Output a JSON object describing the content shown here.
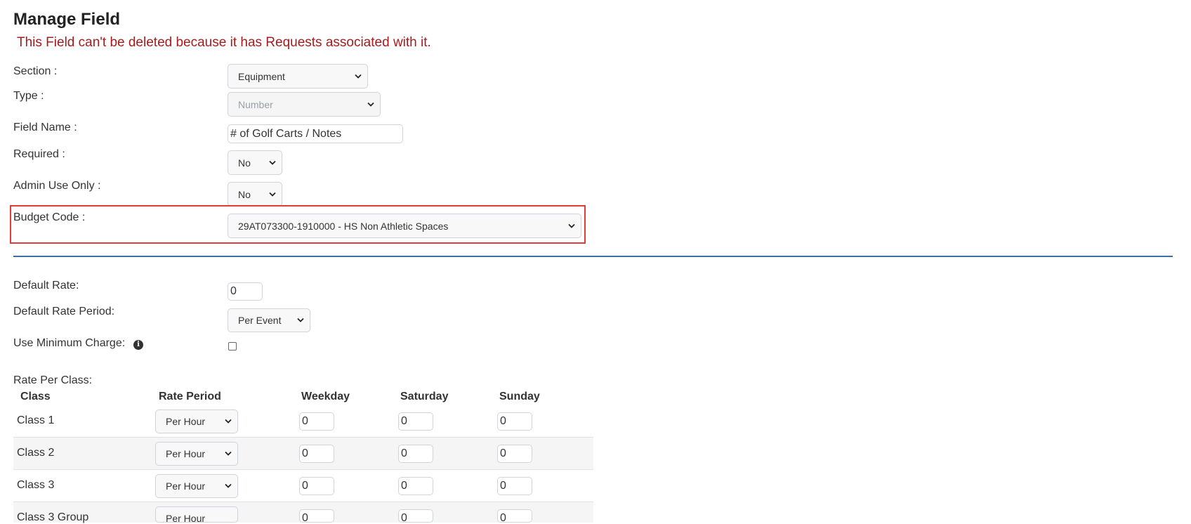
{
  "page": {
    "title": "Manage Field",
    "error_message": "This Field can't be deleted because it has Requests associated with it."
  },
  "form": {
    "section": {
      "label": "Section :",
      "value": "Equipment"
    },
    "type": {
      "label": "Type :",
      "value": "Number"
    },
    "field_name": {
      "label": "Field Name :",
      "value": "# of Golf Carts / Notes"
    },
    "required": {
      "label": "Required :",
      "value": "No"
    },
    "admin_use_only": {
      "label": "Admin Use Only :",
      "value": "No"
    },
    "budget_code": {
      "label": "Budget Code :",
      "value": "29AT073300-1910000 - HS Non Athletic Spaces"
    }
  },
  "rates": {
    "default_rate": {
      "label": "Default Rate:",
      "value": "0"
    },
    "default_rate_period": {
      "label": "Default Rate Period:",
      "value": "Per Event"
    },
    "use_minimum_charge": {
      "label": "Use Minimum Charge:",
      "checked": false,
      "info_icon": "info-circle-icon"
    },
    "rate_per_class": {
      "label": "Rate Per Class:",
      "headers": [
        "Class",
        "Rate Period",
        "Weekday",
        "Saturday",
        "Sunday"
      ],
      "rows": [
        {
          "class": "Class 1",
          "rate_period": "Per Hour",
          "weekday": "0",
          "saturday": "0",
          "sunday": "0"
        },
        {
          "class": "Class 2",
          "rate_period": "Per Hour",
          "weekday": "0",
          "saturday": "0",
          "sunday": "0"
        },
        {
          "class": "Class 3",
          "rate_period": "Per Hour",
          "weekday": "0",
          "saturday": "0",
          "sunday": "0"
        },
        {
          "class": "Class 3 Group",
          "rate_period": "Per Hour",
          "weekday": "0",
          "saturday": "0",
          "sunday": "0"
        }
      ]
    }
  },
  "colors": {
    "error_text": "#a61c1c",
    "highlight_border": "#e33b3b",
    "divider": "#3a6ea5"
  }
}
